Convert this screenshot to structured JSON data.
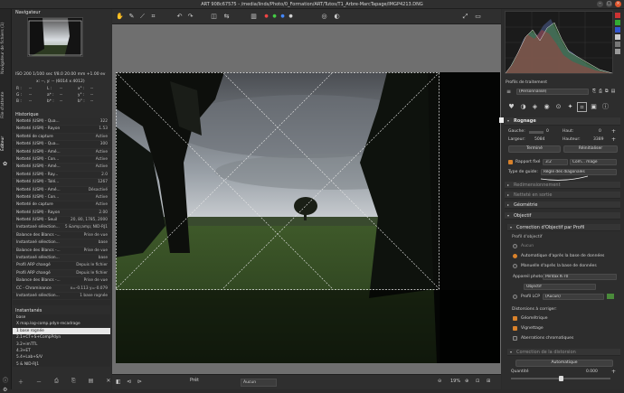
{
  "window": {
    "title": "ART 908c67575 - /media/linds/Photo/0_Formation/ART/Tutos/T1_Arbre-MarcTapage/IMGP4213.DNG"
  },
  "left_tabs": [
    "Navigateur de fichiers (1)",
    "File d'attente",
    "Éditeur"
  ],
  "navigator": {
    "header": "Navigateur",
    "exif": "ISO 200   1/100 sec   f/8.0   20.00 mm  +1.00 ev",
    "coords": "x: --, y: --  (6014 x 4012)",
    "rgb_rows": [
      [
        "R :",
        "--",
        "L :",
        "--",
        "x° :",
        "--"
      ],
      [
        "G :",
        "--",
        "a* :",
        "--",
        "y° :",
        "--"
      ],
      [
        "B :",
        "--",
        "b* :",
        "--",
        "b° :",
        "--"
      ]
    ]
  },
  "history": {
    "header": "Historique",
    "rows": [
      [
        "Netteté (USM) - Qua...",
        "322"
      ],
      [
        "Netteté (USM) - Rayon",
        "1.53"
      ],
      [
        "Netteté de capture",
        "Active"
      ],
      [
        "Netteté (USM) - Qua...",
        "300"
      ],
      [
        "Netteté (USM) - Amé...",
        "Active"
      ],
      [
        "Netteté (USM) - Con...",
        "Active"
      ],
      [
        "Netteté (USM) - Amé...",
        "Active"
      ],
      [
        "Netteté (USM) - Ray...",
        "2.0"
      ],
      [
        "Netteté (USM) - Tolé...",
        "1267"
      ],
      [
        "Netteté (USM) - Amé...",
        "Désactivé"
      ],
      [
        "Netteté (USM) - Con...",
        "Active"
      ],
      [
        "Netteté de capture",
        "Active"
      ],
      [
        "Netteté (USM) - Rayon",
        "2.00"
      ],
      [
        "Netteté (USM) - Seuil",
        "20, 80, 1785, 2000"
      ],
      [
        "Instantané sélection...",
        "5 &amp;amp; NID-RJ1"
      ],
      [
        "Balance des Blancs -...",
        "Prise de vue"
      ],
      [
        "Instantané sélection...",
        "base"
      ],
      [
        "Balance des Blancs -...",
        "Prise de vue"
      ],
      [
        "Instantané sélection...",
        "base"
      ],
      [
        "Profil ARP changé",
        "Depuis le fichier"
      ],
      [
        "Profil ARP changé",
        "Depuis le fichier"
      ],
      [
        "Balance des Blancs -...",
        "Prise de vue"
      ],
      [
        "CC - Chrominance",
        "x=-0.113 y=-0.079"
      ],
      [
        "Instantané sélection...",
        "1 base rognée"
      ]
    ]
  },
  "snapshots": {
    "header": "Instantanés",
    "items": [
      "base",
      "X map.log-comp.pdyn-recadrage",
      "1 base rognée",
      "2.1+CT+S+CompPdyn",
      "3.2+imTTL",
      "4.3+ET",
      "5.4+Lab+S/V",
      "5 & NID-RJ1"
    ],
    "selected_index": 2
  },
  "editor": {
    "bottom": {
      "ready": "Prêt",
      "view_mode": "Aucun",
      "zoom": "19%"
    }
  },
  "right": {
    "profile_header": "Profils de traitement",
    "profile_value": "(Personnalisé)",
    "crop": {
      "title": "Rognage",
      "x_label": "Gauche:",
      "x_value": "0",
      "y_label": "Haut:",
      "y_value": "0",
      "w_label": "Largeur:",
      "w_value": "5084",
      "h_label": "Hauteur:",
      "h_value": "3389",
      "done_btn": "Terminé",
      "reset_btn": "Réinitialiser",
      "ratio_label": "Rapport fixé",
      "ratio_value": "3:2",
      "ratio_orient": "Com... mage",
      "guide_label": "Type de guide:",
      "guide_value": "Règle des diagonales"
    },
    "sections": [
      {
        "title": "Redimensionnement",
        "enabled": false
      },
      {
        "title": "Netteté en sortie",
        "enabled": false
      },
      {
        "title": "Géométrie",
        "enabled": true
      },
      {
        "title": "Objectif",
        "enabled": true
      }
    ],
    "lens": {
      "title": "Correction d'Objectif par Profil",
      "profile_label": "Profil d'objectif",
      "opt_none": "Aucun",
      "opt_auto": "Automatique d'après la base de données",
      "opt_manual": "Manuelle d'après la base de données",
      "camera_label": "Appareil photo",
      "camera_value": "Pentax K-70",
      "lens_value": "Objectif",
      "lcp_label": "Profil LCP",
      "lcp_value": "(Aucun)",
      "distort_label": "Distorsions à corriger:",
      "geo": "Géométrique",
      "vignette": "Vignettage",
      "ca": "Aberrations chromatiques"
    },
    "distortion": {
      "title": "Correction de la distorsion",
      "mode": "Automatique",
      "quality_label": "Quantité",
      "quality_value": "0.000"
    }
  },
  "colors": {
    "accent": "#d9822b",
    "panel": "#2d2d2d",
    "canvas": "#6f6f6f"
  }
}
